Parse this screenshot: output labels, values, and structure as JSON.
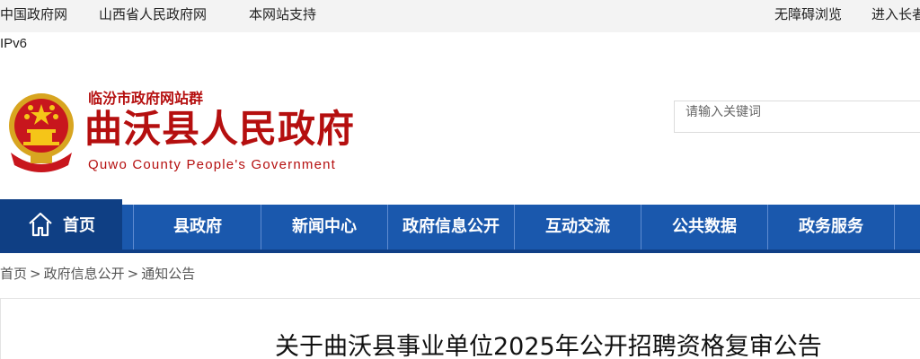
{
  "topbar": {
    "links": [
      "中国政府网",
      "山西省人民政府网",
      "本网站支持"
    ],
    "right_links": [
      "无障碍浏览",
      "进入长者模式"
    ]
  },
  "ipv6": "IPv6",
  "header": {
    "group_name": "临汾市政府网站群",
    "site_name": "曲沃县人民政府",
    "site_name_en": "Quwo County People's Government"
  },
  "search": {
    "placeholder": "请输入关键词"
  },
  "colors": {
    "brand_red": "#b50f0f",
    "nav_blue": "#1a58ad",
    "nav_home_dark": "#0f3f84"
  },
  "nav": {
    "home": "首页",
    "items": [
      "县政府",
      "新闻中心",
      "政府信息公开",
      "互动交流",
      "公共数据",
      "政务服务"
    ]
  },
  "breadcrumb": [
    "首页",
    "政府信息公开",
    "通知公告"
  ],
  "article": {
    "title": "关于曲沃县事业单位2025年公开招聘资格复审公告"
  }
}
